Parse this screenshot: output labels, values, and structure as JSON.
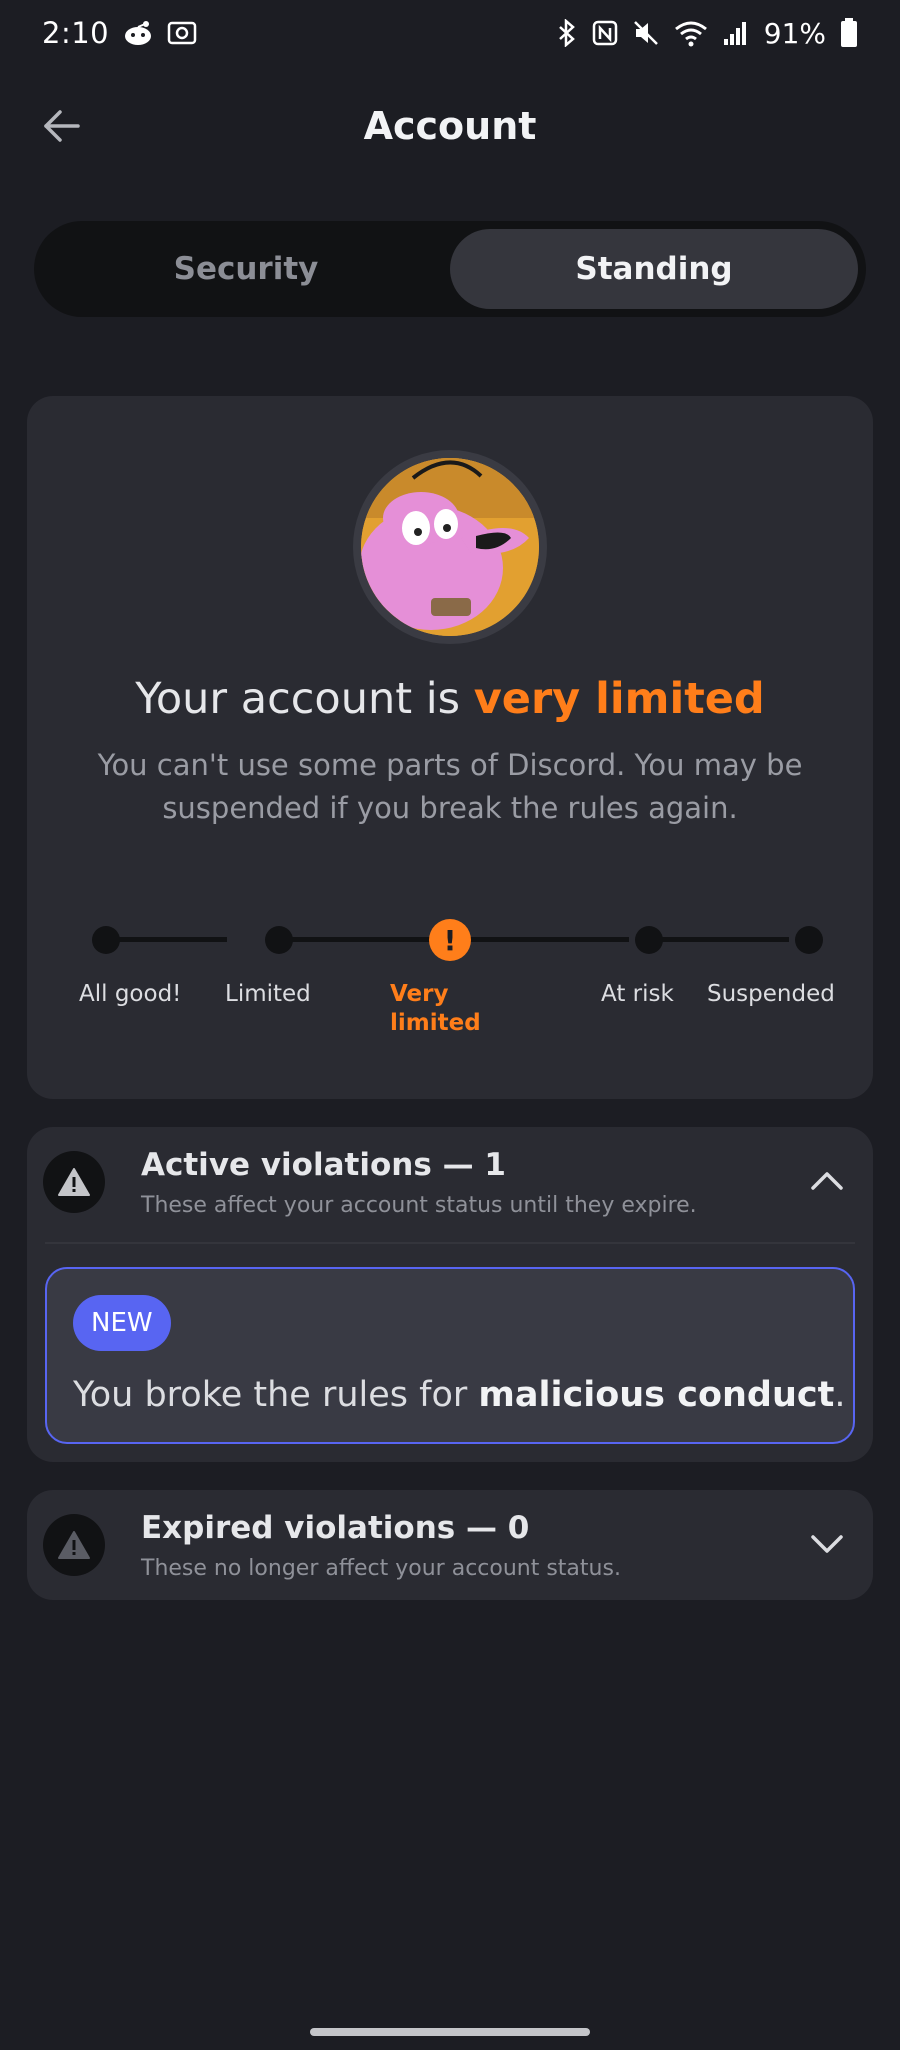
{
  "status_bar": {
    "time": "2:10",
    "battery": "91%",
    "left_icons": [
      "reddit-icon",
      "screenshot-icon"
    ],
    "right_icons": [
      "bluetooth-icon",
      "nfc-icon",
      "mute-icon",
      "wifi-icon",
      "signal-icon",
      "battery-icon"
    ]
  },
  "header": {
    "title": "Account",
    "back_icon": "arrow-left-icon"
  },
  "tabs": [
    {
      "label": "Security",
      "active": false
    },
    {
      "label": "Standing",
      "active": true
    }
  ],
  "standing": {
    "heading_prefix": "Your account is ",
    "heading_highlight": "very limited",
    "description": "You can't use some parts of Discord. You may be suspended if you break the rules again.",
    "current_step": 2,
    "steps": [
      {
        "label": "All good!"
      },
      {
        "label": "Limited"
      },
      {
        "label_line1": "Very",
        "label_line2": "limited"
      },
      {
        "label": "At risk"
      },
      {
        "label": "Suspended"
      }
    ],
    "current_marker": "!"
  },
  "active_violations": {
    "title": "Active violations — 1",
    "subtitle": "These affect your account status until they expire.",
    "expanded": true,
    "items": [
      {
        "badge": "NEW",
        "text_prefix": "You broke the rules for ",
        "text_bold": "malicious conduct",
        "text_suffix": "."
      }
    ]
  },
  "expired_violations": {
    "title": "Expired violations — 0",
    "subtitle": "These no longer affect your account status.",
    "expanded": false
  },
  "colors": {
    "background": "#1c1d23",
    "card": "#2a2b32",
    "accent_orange": "#ff7e1a",
    "blurple": "#5865f2"
  }
}
